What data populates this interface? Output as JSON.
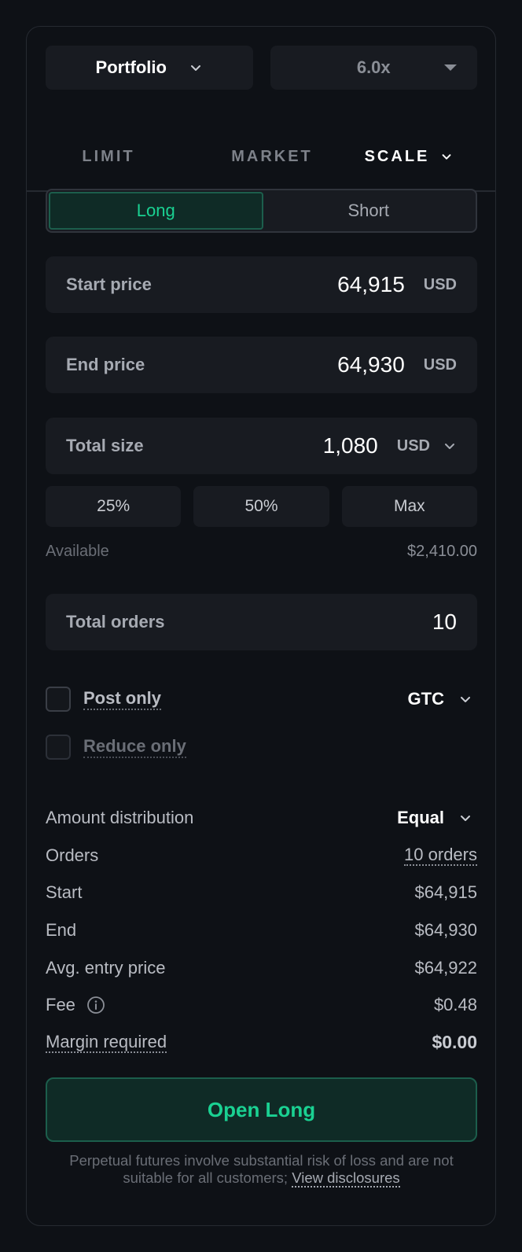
{
  "header": {
    "account_label": "Portfolio",
    "leverage_label": "6.0x"
  },
  "tabs": {
    "limit": "LIMIT",
    "market": "MARKET",
    "scale": "SCALE"
  },
  "side": {
    "long": "Long",
    "short": "Short"
  },
  "start_price": {
    "label": "Start price",
    "value": "64,915",
    "unit": "USD"
  },
  "end_price": {
    "label": "End price",
    "value": "64,930",
    "unit": "USD"
  },
  "total_size": {
    "label": "Total size",
    "value": "1,080",
    "unit": "USD"
  },
  "percent_buttons": [
    "25%",
    "50%",
    "Max"
  ],
  "available": {
    "label": "Available",
    "value": "$2,410.00"
  },
  "total_orders": {
    "label": "Total orders",
    "value": "10"
  },
  "options": {
    "post_only": "Post only",
    "reduce_only": "Reduce only",
    "time_in_force": "GTC"
  },
  "summary": {
    "distribution_label": "Amount distribution",
    "distribution_value": "Equal",
    "orders_label": "Orders",
    "orders_value": "10 orders",
    "start_label": "Start",
    "start_value": "$64,915",
    "end_label": "End",
    "end_value": "$64,930",
    "avg_entry_label": "Avg. entry price",
    "avg_entry_value": "$64,922",
    "fee_label": "Fee",
    "fee_value": "$0.48",
    "margin_label": "Margin required",
    "margin_value": "$0.00"
  },
  "submit_label": "Open Long",
  "disclaimer": {
    "text": "Perpetual futures involve substantial risk of loss and are not suitable for all customers;",
    "link": "View disclosures"
  },
  "colors": {
    "accent_green": "#1ad192",
    "background": "#0e1116",
    "surface": "#181b21"
  }
}
